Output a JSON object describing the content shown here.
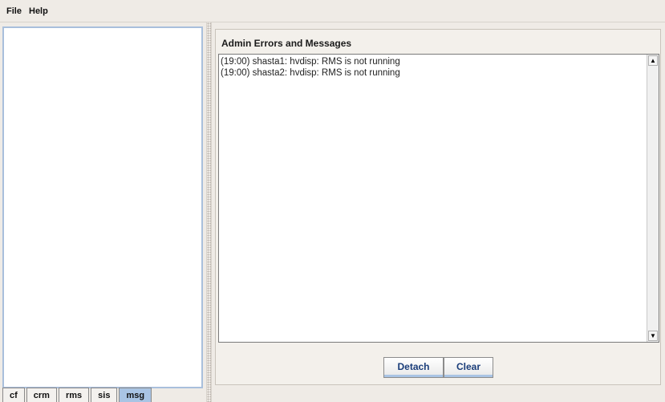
{
  "menu": {
    "file": "File",
    "help": "Help"
  },
  "tabs": [
    {
      "label": "cf",
      "active": false
    },
    {
      "label": "crm",
      "active": false
    },
    {
      "label": "rms",
      "active": false
    },
    {
      "label": "sis",
      "active": false
    },
    {
      "label": "msg",
      "active": true
    }
  ],
  "messages": {
    "title": "Admin Errors and Messages",
    "lines": [
      "(19:00) shasta1: hvdisp: RMS is not running",
      "(19:00) shasta2: hvdisp: RMS is not running"
    ]
  },
  "buttons": {
    "detach": "Detach",
    "clear": "Clear"
  },
  "colors": {
    "accent": "#a9c4e4",
    "panel_bg": "#efebe6"
  }
}
